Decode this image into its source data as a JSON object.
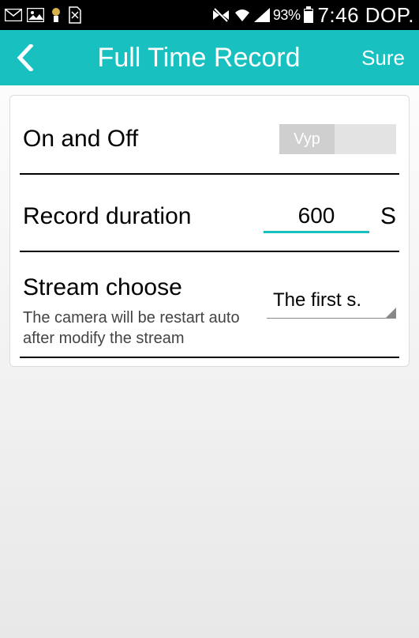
{
  "statusbar": {
    "battery_pct": "93%",
    "clock": "7:46 DOP."
  },
  "appbar": {
    "title": "Full Time Record",
    "action": "Sure"
  },
  "settings": {
    "on_off": {
      "label": "On and Off",
      "state": "Vyp"
    },
    "duration": {
      "label": "Record duration",
      "value": "600",
      "unit": "S"
    },
    "stream": {
      "label": "Stream choose",
      "value": "The first s.",
      "note": "The camera will be restart auto after modify the stream"
    }
  }
}
